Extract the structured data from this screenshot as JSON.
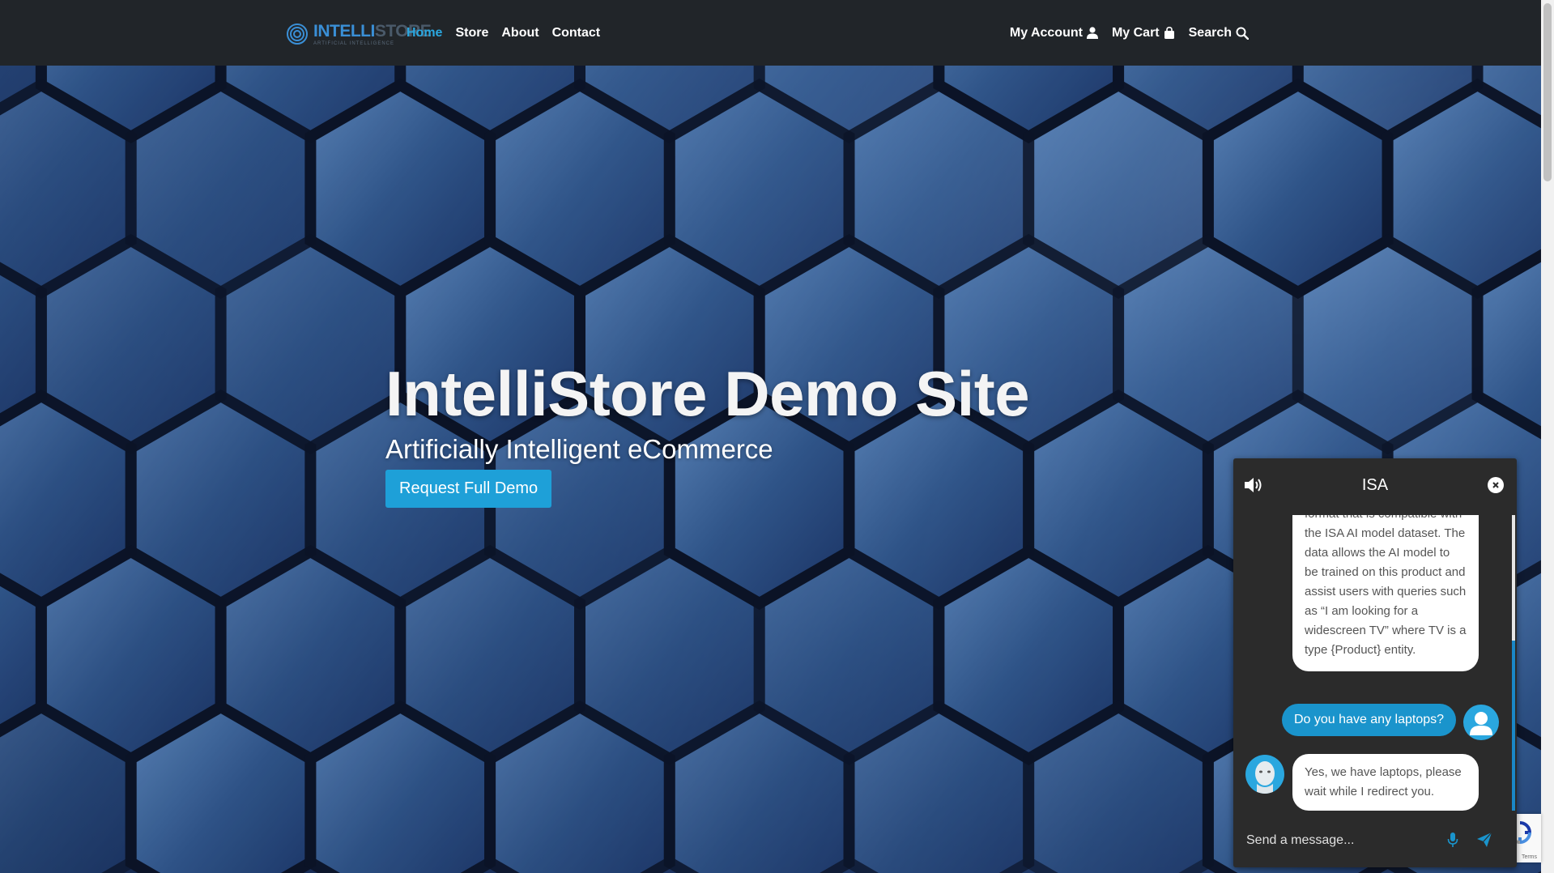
{
  "brand": {
    "logo_main": "INTELLI",
    "logo_main_dim": "STORE",
    "logo_sub": "ARTIFICIAL INTELLIGENCE"
  },
  "nav": {
    "left": [
      "Home",
      "Store",
      "About",
      "Contact"
    ],
    "active": "Home",
    "account": "My Account",
    "cart": "My Cart",
    "search": "Search"
  },
  "hero": {
    "title": "IntelliStore Demo Site",
    "subtitle": "Artificially Intelligent eCommerce",
    "button": "Request Full Demo"
  },
  "chat": {
    "title": "ISA",
    "messages": [
      {
        "from": "bot",
        "text": "format that is compatible with the ISA AI model dataset. The data allows the AI model to be trained on this product and assist users with queries such as “I am looking for a widescreen TV” where TV is a type {Product} entity."
      },
      {
        "from": "user",
        "text": "Do you have any laptops?"
      },
      {
        "from": "bot",
        "text": "Yes, we have laptops, please wait while I redirect you."
      }
    ],
    "input_placeholder": "Send a message..."
  },
  "recaptcha": {
    "terms": "Terms"
  },
  "colors": {
    "navbar": "#212529",
    "accent": "#2aa7df",
    "chat_bg": "#2b2b2b"
  }
}
